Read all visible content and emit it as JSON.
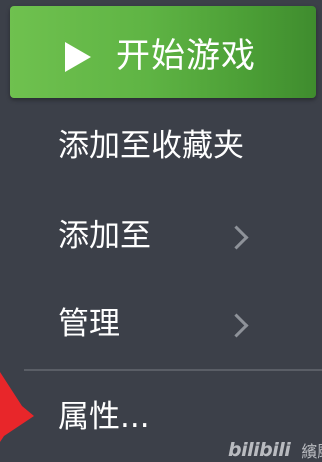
{
  "menu": {
    "play_button": {
      "icon": "play-icon",
      "label": "开始游戏",
      "color_start": "#6fc14f",
      "color_end": "#3f8c2e"
    },
    "items": [
      {
        "label": "添加至收藏夹",
        "has_submenu": false
      },
      {
        "label": "添加至",
        "has_submenu": true,
        "submenu_icon": "chevron-right-icon"
      },
      {
        "label": "管理",
        "has_submenu": true,
        "submenu_icon": "chevron-right-icon"
      },
      {
        "label": "属性...",
        "has_submenu": false
      }
    ],
    "background": "#3c4049"
  },
  "overlay": {
    "arrow_icon": "red-arrow-icon",
    "arrow_color": "#e8262a",
    "watermark_logo": "bilibili",
    "watermark_text": "繽颺"
  }
}
